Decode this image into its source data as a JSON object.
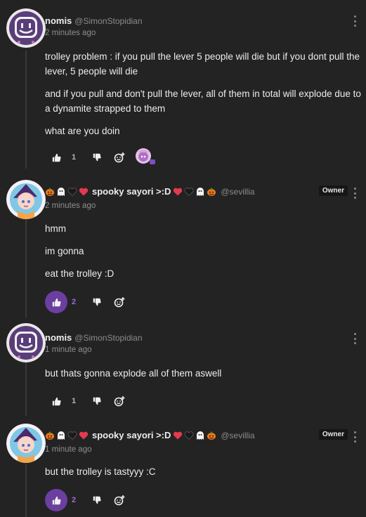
{
  "comments": [
    {
      "author": "nomis",
      "handle": "@SimonStopidian",
      "time": "2 minutes ago",
      "paragraphs": [
        "trolley problem : if you pull the lever 5 people will die but if you dont pull the lever, 5 people will die",
        "and if you pull and don't pull the lever, all of them in total will explode due to a dynamite strapped to them",
        "what are you doin"
      ],
      "likes": "1"
    },
    {
      "author": "spooky sayori >:D",
      "handle": "@sevillia",
      "badge": "Owner",
      "time": "2 minutes ago",
      "paragraphs": [
        "hmm",
        "im gonna",
        "eat the trolley :D"
      ],
      "likes": "2"
    },
    {
      "author": "nomis",
      "handle": "@SimonStopidian",
      "time": "1 minute ago",
      "paragraphs": [
        "but thats gonna explode all of them aswell"
      ],
      "likes": "1"
    },
    {
      "author": "spooky sayori >:D",
      "handle": "@sevillia",
      "badge": "Owner",
      "time": "1 minute ago",
      "paragraphs": [
        "but the trolley is tastyyy :C"
      ],
      "likes": "2"
    }
  ],
  "colors": {
    "background": "#232323",
    "accent_purple": "#6b3fa0",
    "muted_text": "#8e8e8e"
  },
  "icons": {
    "like": "thumbs-up-icon",
    "dislike": "thumbs-down-icon",
    "react": "add-reaction-icon",
    "menu": "kebab-menu-icon"
  }
}
